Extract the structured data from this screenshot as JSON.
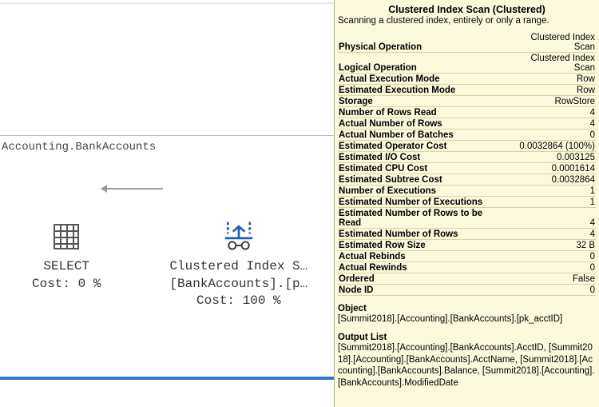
{
  "query_text": "Accounting.BankAccounts",
  "plan": {
    "select": {
      "label1": "SELECT",
      "label2": "Cost: 0 %"
    },
    "scan": {
      "label1": "Clustered Index S…",
      "label2": "[BankAccounts].[p…",
      "label3": "Cost: 100 %"
    }
  },
  "tooltip": {
    "title": "Clustered Index Scan (Clustered)",
    "subtitle": "Scanning a clustered index, entirely or only a range.",
    "props": [
      {
        "k": "Physical Operation",
        "v": "Clustered Index Scan"
      },
      {
        "k": "Logical Operation",
        "v": "Clustered Index Scan"
      },
      {
        "k": "Actual Execution Mode",
        "v": "Row"
      },
      {
        "k": "Estimated Execution Mode",
        "v": "Row"
      },
      {
        "k": "Storage",
        "v": "RowStore"
      },
      {
        "k": "Number of Rows Read",
        "v": "4"
      },
      {
        "k": "Actual Number of Rows",
        "v": "4"
      },
      {
        "k": "Actual Number of Batches",
        "v": "0"
      },
      {
        "k": "Estimated Operator Cost",
        "v": "0.0032864 (100%)"
      },
      {
        "k": "Estimated I/O Cost",
        "v": "0.003125"
      },
      {
        "k": "Estimated CPU Cost",
        "v": "0.0001614"
      },
      {
        "k": "Estimated Subtree Cost",
        "v": "0.0032864"
      },
      {
        "k": "Number of Executions",
        "v": "1"
      },
      {
        "k": "Estimated Number of Executions",
        "v": "1"
      },
      {
        "k": "Estimated Number of Rows to be Read",
        "v": "4"
      },
      {
        "k": "Estimated Number of Rows",
        "v": "4"
      },
      {
        "k": "Estimated Row Size",
        "v": "32 B"
      },
      {
        "k": "Actual Rebinds",
        "v": "0"
      },
      {
        "k": "Actual Rewinds",
        "v": "0"
      },
      {
        "k": "Ordered",
        "v": "False"
      },
      {
        "k": "Node ID",
        "v": "0"
      }
    ],
    "object_label": "Object",
    "object_value": "[Summit2018].[Accounting].[BankAccounts].[pk_acctID]",
    "output_label": "Output List",
    "output_value": "[Summit2018].[Accounting].[BankAccounts].AcctID, [Summit2018].[Accounting].[BankAccounts].AcctName, [Summit2018].[Accounting].[BankAccounts].Balance, [Summit2018].[Accounting].[BankAccounts].ModifiedDate"
  },
  "chart_data": {
    "type": "table",
    "title": "Clustered Index Scan (Clustered)",
    "rows": [
      [
        "Physical Operation",
        "Clustered Index Scan"
      ],
      [
        "Logical Operation",
        "Clustered Index Scan"
      ],
      [
        "Actual Execution Mode",
        "Row"
      ],
      [
        "Estimated Execution Mode",
        "Row"
      ],
      [
        "Storage",
        "RowStore"
      ],
      [
        "Number of Rows Read",
        4
      ],
      [
        "Actual Number of Rows",
        4
      ],
      [
        "Actual Number of Batches",
        0
      ],
      [
        "Estimated Operator Cost",
        "0.0032864 (100%)"
      ],
      [
        "Estimated I/O Cost",
        0.003125
      ],
      [
        "Estimated CPU Cost",
        0.0001614
      ],
      [
        "Estimated Subtree Cost",
        0.0032864
      ],
      [
        "Number of Executions",
        1
      ],
      [
        "Estimated Number of Executions",
        1
      ],
      [
        "Estimated Number of Rows to be Read",
        4
      ],
      [
        "Estimated Number of Rows",
        4
      ],
      [
        "Estimated Row Size",
        "32 B"
      ],
      [
        "Actual Rebinds",
        0
      ],
      [
        "Actual Rewinds",
        0
      ],
      [
        "Ordered",
        "False"
      ],
      [
        "Node ID",
        0
      ]
    ]
  }
}
